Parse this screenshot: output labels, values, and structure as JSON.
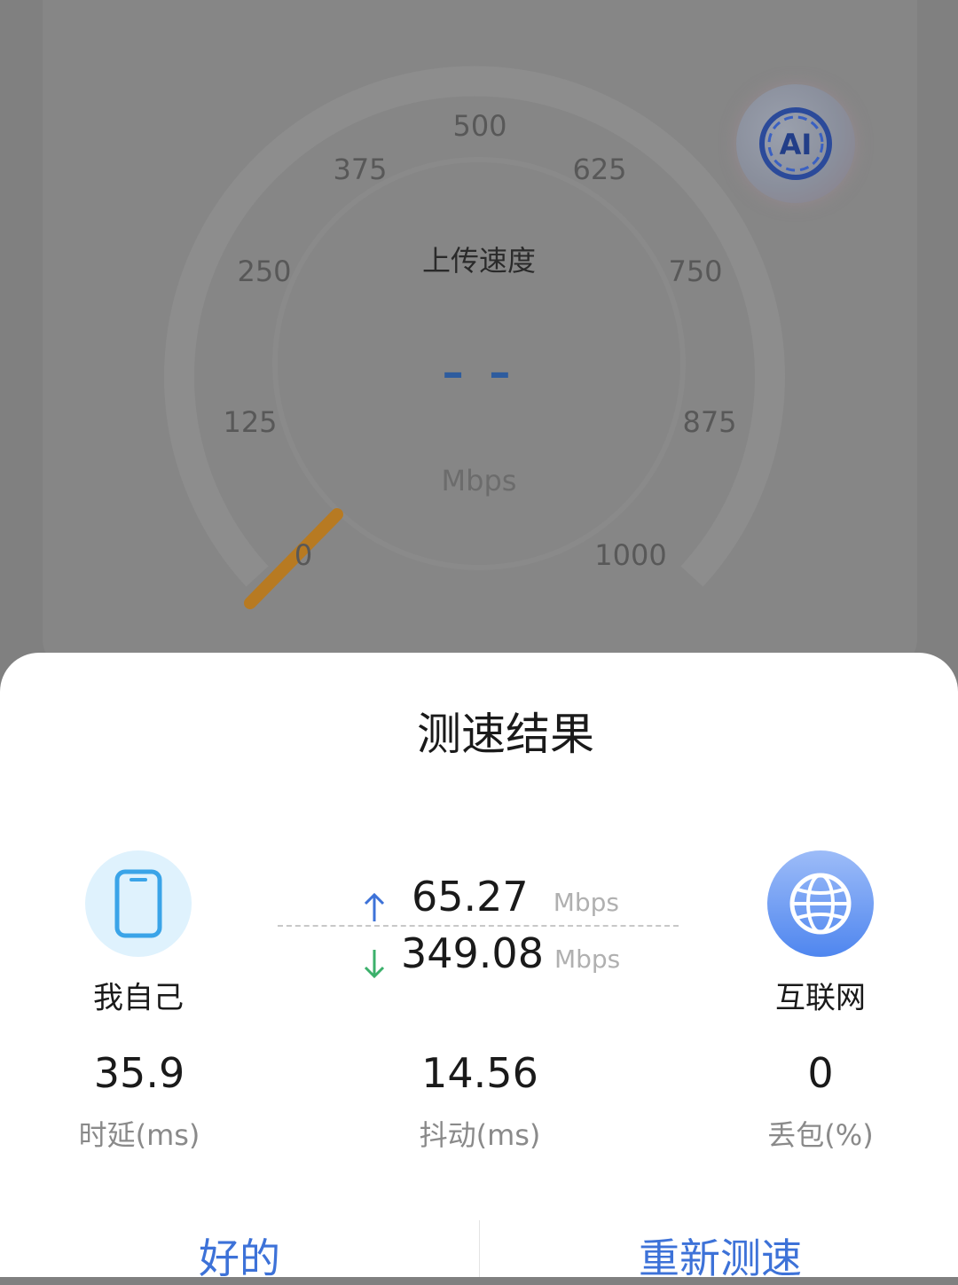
{
  "gauge": {
    "title": "上传速度",
    "value": "– –",
    "unit": "Mbps",
    "ticks": [
      "0",
      "125",
      "250",
      "375",
      "500",
      "625",
      "750",
      "875",
      "1000"
    ],
    "needle_value": 0
  },
  "ai_badge": {
    "label": "AI"
  },
  "result": {
    "title": "测速结果",
    "self_label": "我自己",
    "internet_label": "互联网",
    "upload": {
      "value": "65.27",
      "unit": "Mbps"
    },
    "download": {
      "value": "349.08",
      "unit": "Mbps"
    },
    "metrics": [
      {
        "value": "35.9",
        "label": "时延(ms)"
      },
      {
        "value": "14.56",
        "label": "抖动(ms)"
      },
      {
        "value": "0",
        "label": "丢包(%)"
      }
    ],
    "ok_label": "好的",
    "retest_label": "重新测速"
  },
  "colors": {
    "accent": "#3d72d8",
    "upload_arrow": "#3d72d8",
    "download_arrow": "#3bb06b",
    "needle": "#b77a22"
  }
}
